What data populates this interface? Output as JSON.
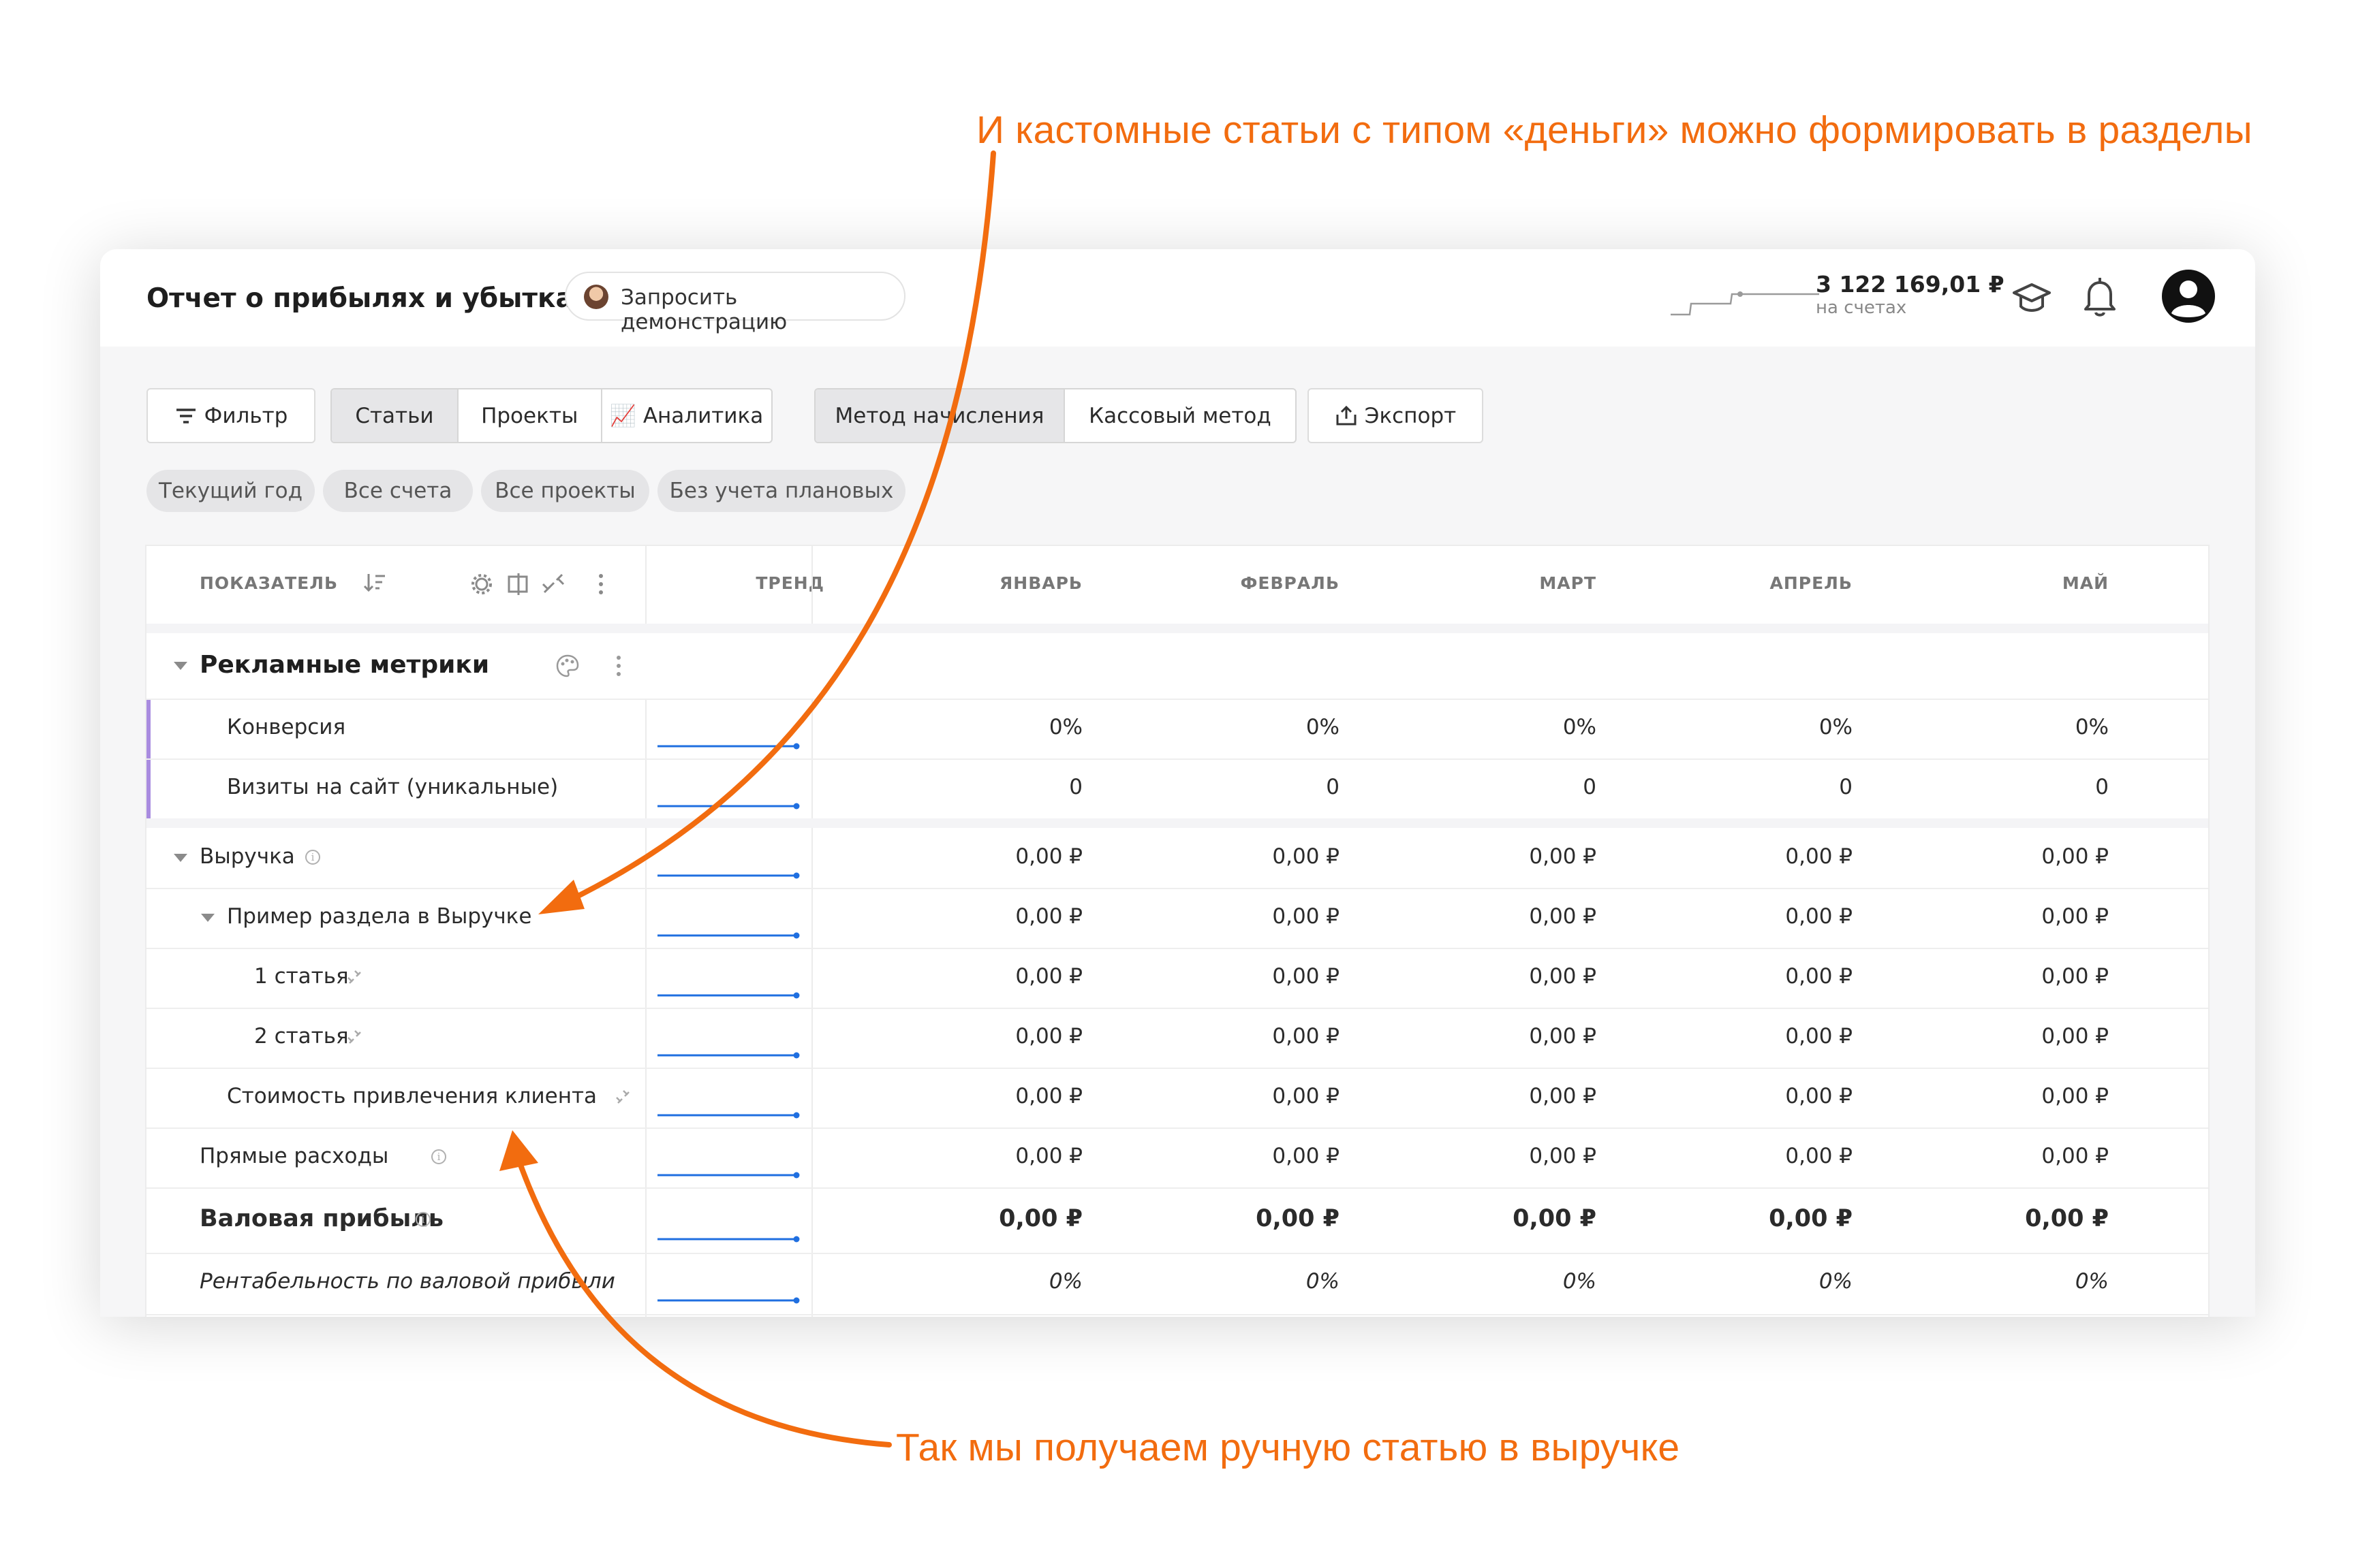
{
  "annotations": {
    "top": "И кастомные статьи с типом «деньги» можно формировать в разделы",
    "bottom": "Так мы получаем ручную статью в выручке",
    "accent_color": "#f26c0f"
  },
  "header": {
    "title": "Отчет о прибылях и убытках",
    "demo_button": "Запросить демонстрацию",
    "balance": "3 122 169,01 ₽",
    "balance_caption": "на счетах",
    "icons": [
      "graduation-cap-icon",
      "bell-icon",
      "user-avatar-icon"
    ]
  },
  "toolbar": {
    "filter": "Фильтр",
    "view_tabs": [
      "Статьи",
      "Проекты",
      "📈 Аналитика"
    ],
    "active_view": "Статьи",
    "method_tabs": [
      "Метод начисления",
      "Кассовый метод"
    ],
    "active_method": "Метод начисления",
    "export": "Экспорт"
  },
  "chips": [
    "Текущий год",
    "Все счета",
    "Все проекты",
    "Без учета плановых"
  ],
  "table": {
    "columns": {
      "indicator": "ПОКАЗАТЕЛЬ",
      "trend": "ТРЕНД",
      "months": [
        "ЯНВАРЬ",
        "ФЕВРАЛЬ",
        "МАРТ",
        "АПРЕЛЬ",
        "МАЙ"
      ]
    },
    "category": "Рекламные метрики",
    "rows": [
      {
        "label": "Конверсия",
        "values": [
          "0%",
          "0%",
          "0%",
          "0%",
          "0%"
        ]
      },
      {
        "label": "Визиты на сайт (уникальные)",
        "values": [
          "0",
          "0",
          "0",
          "0",
          "0"
        ]
      },
      {
        "label": "Выручка",
        "values": [
          "0,00 ₽",
          "0,00 ₽",
          "0,00 ₽",
          "0,00 ₽",
          "0,00 ₽"
        ]
      },
      {
        "label": "Пример раздела в Выручке",
        "values": [
          "0,00 ₽",
          "0,00 ₽",
          "0,00 ₽",
          "0,00 ₽",
          "0,00 ₽"
        ]
      },
      {
        "label": "1 статья",
        "values": [
          "0,00 ₽",
          "0,00 ₽",
          "0,00 ₽",
          "0,00 ₽",
          "0,00 ₽"
        ]
      },
      {
        "label": "2 статья",
        "values": [
          "0,00 ₽",
          "0,00 ₽",
          "0,00 ₽",
          "0,00 ₽",
          "0,00 ₽"
        ]
      },
      {
        "label": "Стоимость привлечения клиента",
        "values": [
          "0,00 ₽",
          "0,00 ₽",
          "0,00 ₽",
          "0,00 ₽",
          "0,00 ₽"
        ]
      },
      {
        "label": "Прямые расходы",
        "values": [
          "0,00 ₽",
          "0,00 ₽",
          "0,00 ₽",
          "0,00 ₽",
          "0,00 ₽"
        ]
      },
      {
        "label": "Валовая прибыль",
        "values": [
          "0,00 ₽",
          "0,00 ₽",
          "0,00 ₽",
          "0,00 ₽",
          "0,00 ₽"
        ]
      },
      {
        "label": "Рентабельность по валовой прибыли",
        "values": [
          "0%",
          "0%",
          "0%",
          "0%",
          "0%"
        ]
      }
    ],
    "trend_color": "#1f6fe0",
    "category_accent": "#a98ce0"
  }
}
